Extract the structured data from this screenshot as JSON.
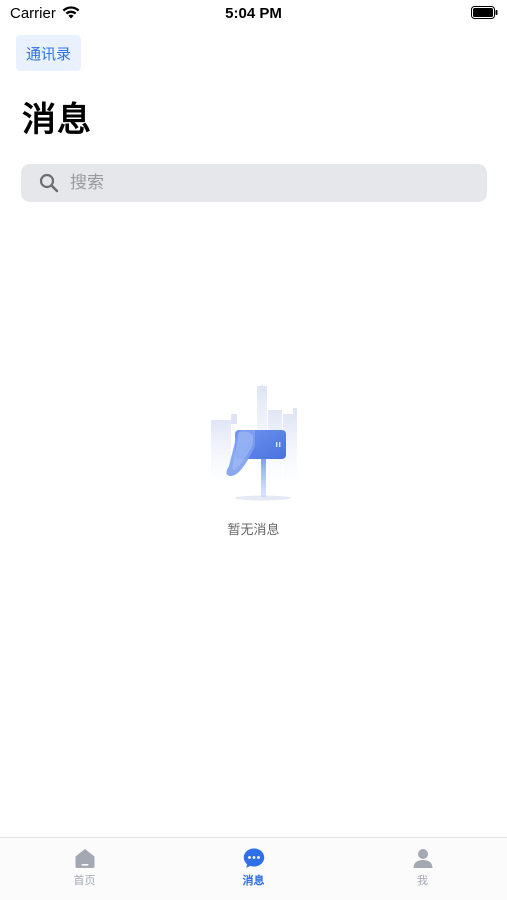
{
  "status_bar": {
    "carrier": "Carrier",
    "time": "5:04 PM"
  },
  "header": {
    "contacts_label": "通讯录",
    "title": "消息"
  },
  "search": {
    "placeholder": "搜索"
  },
  "empty_state": {
    "text": "暂无消息"
  },
  "tab_bar": {
    "items": [
      {
        "label": "首页",
        "icon": "home-icon",
        "active": false
      },
      {
        "label": "消息",
        "icon": "chat-icon",
        "active": true
      },
      {
        "label": "我",
        "icon": "person-icon",
        "active": false
      }
    ]
  },
  "colors": {
    "accent": "#2f6fe8",
    "contacts_bg": "#e9f1ff",
    "search_bg": "#e6e7ea",
    "tab_inactive": "#a3a8b3"
  }
}
